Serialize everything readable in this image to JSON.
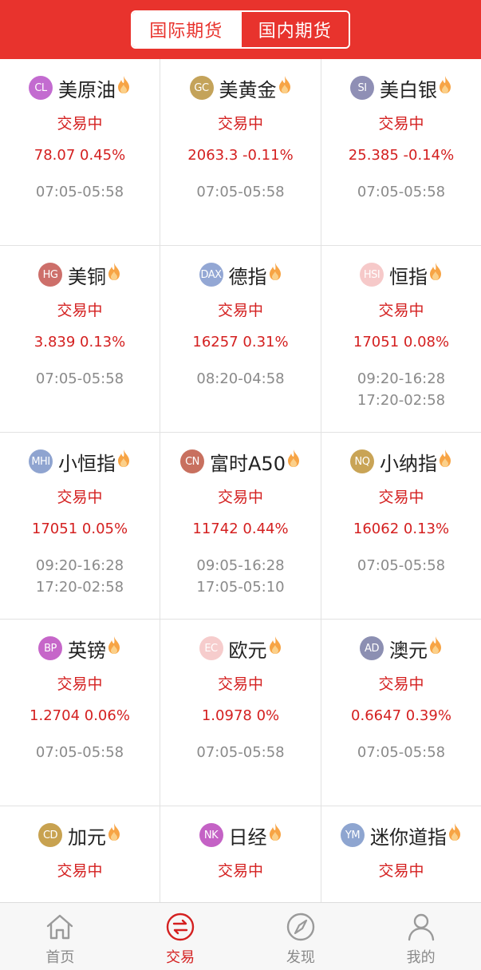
{
  "header": {
    "tabs": [
      {
        "label": "国际期货",
        "active": true
      },
      {
        "label": "国内期货",
        "active": false
      }
    ]
  },
  "colors": {
    "accent": "#e8332d",
    "price_red": "#d42020",
    "muted": "#8a8a8a"
  },
  "products": [
    {
      "code": "CL",
      "name": "美原油",
      "badge_color": "#c36bd0",
      "status": "交易中",
      "quote": "78.07 0.45%",
      "hours": [
        "07:05-05:58"
      ]
    },
    {
      "code": "GC",
      "name": "美黄金",
      "badge_color": "#c4a35a",
      "status": "交易中",
      "quote": "2063.3 -0.11%",
      "hours": [
        "07:05-05:58"
      ]
    },
    {
      "code": "SI",
      "name": "美白银",
      "badge_color": "#8f8fb5",
      "status": "交易中",
      "quote": "25.385 -0.14%",
      "hours": [
        "07:05-05:58"
      ]
    },
    {
      "code": "HG",
      "name": "美铜",
      "badge_color": "#cd6f6a",
      "status": "交易中",
      "quote": "3.839 0.13%",
      "hours": [
        "07:05-05:58"
      ]
    },
    {
      "code": "DAX",
      "name": "德指",
      "badge_color": "#93a7d4",
      "status": "交易中",
      "quote": "16257 0.31%",
      "hours": [
        "08:20-04:58"
      ]
    },
    {
      "code": "HSI",
      "name": "恒指",
      "badge_color": "#f6c9c9",
      "status": "交易中",
      "quote": "17051 0.08%",
      "hours": [
        "09:20-16:28",
        "17:20-02:58"
      ]
    },
    {
      "code": "MHI",
      "name": "小恒指",
      "badge_color": "#8fa4d0",
      "status": "交易中",
      "quote": "17051 0.05%",
      "hours": [
        "09:20-16:28",
        "17:20-02:58"
      ]
    },
    {
      "code": "CN",
      "name": "富时A50",
      "badge_color": "#c8705f",
      "status": "交易中",
      "quote": "11742 0.44%",
      "hours": [
        "09:05-16:28",
        "17:05-05:10"
      ]
    },
    {
      "code": "NQ",
      "name": "小纳指",
      "badge_color": "#c9a456",
      "status": "交易中",
      "quote": "16062 0.13%",
      "hours": [
        "07:05-05:58"
      ]
    },
    {
      "code": "BP",
      "name": "英镑",
      "badge_color": "#c666c9",
      "status": "交易中",
      "quote": "1.2704 0.06%",
      "hours": [
        "07:05-05:58"
      ]
    },
    {
      "code": "EC",
      "name": "欧元",
      "badge_color": "#f6cccc",
      "status": "交易中",
      "quote": "1.0978 0%",
      "hours": [
        "07:05-05:58"
      ]
    },
    {
      "code": "AD",
      "name": "澳元",
      "badge_color": "#8c8fb2",
      "status": "交易中",
      "quote": "0.6647 0.39%",
      "hours": [
        "07:05-05:58"
      ]
    },
    {
      "code": "CD",
      "name": "加元",
      "badge_color": "#c8a250",
      "status": "交易中",
      "quote": "",
      "hours": []
    },
    {
      "code": "NK",
      "name": "日经",
      "badge_color": "#c462c5",
      "status": "交易中",
      "quote": "",
      "hours": []
    },
    {
      "code": "YM",
      "name": "迷你道指",
      "badge_color": "#8ea5d0",
      "status": "交易中",
      "quote": "",
      "hours": []
    }
  ],
  "tabbar": {
    "items": [
      {
        "label": "首页",
        "icon": "home-icon",
        "active": false
      },
      {
        "label": "交易",
        "icon": "exchange-icon",
        "active": true
      },
      {
        "label": "发现",
        "icon": "compass-icon",
        "active": false
      },
      {
        "label": "我的",
        "icon": "user-icon",
        "active": false
      }
    ]
  }
}
